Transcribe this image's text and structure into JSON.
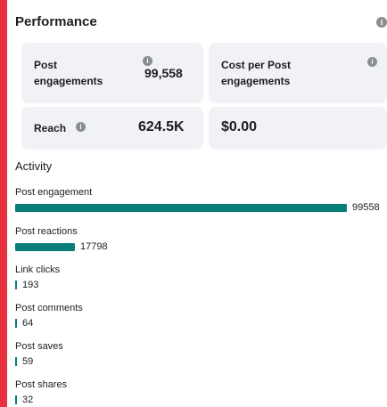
{
  "performance": {
    "title": "Performance",
    "cards": {
      "post_engagements": {
        "label_line1": "Post",
        "label_line2": "engagements",
        "value": "99,558"
      },
      "cost_per_post": {
        "label_line1": "Cost per Post",
        "label_line2": "engagements",
        "value": ""
      },
      "reach": {
        "label": "Reach",
        "value": "624.5K"
      },
      "cost_value": {
        "value": "$0.00"
      }
    }
  },
  "activity": {
    "title": "Activity",
    "metrics": [
      {
        "label": "Post engagement",
        "value": "99558",
        "fraction": 1.0
      },
      {
        "label": "Post reactions",
        "value": "17798",
        "fraction": 0.179
      },
      {
        "label": "Link clicks",
        "value": "193",
        "fraction": 0.0019
      },
      {
        "label": "Post comments",
        "value": "64",
        "fraction": 0.0006
      },
      {
        "label": "Post saves",
        "value": "59",
        "fraction": 0.0006
      },
      {
        "label": "Post shares",
        "value": "32",
        "fraction": 0.0003
      }
    ]
  },
  "colors": {
    "bar": "#0a7e7a",
    "card_bg": "#f0f2f5",
    "outer_border": "#e8313f"
  },
  "icons": [
    "info-icon"
  ]
}
